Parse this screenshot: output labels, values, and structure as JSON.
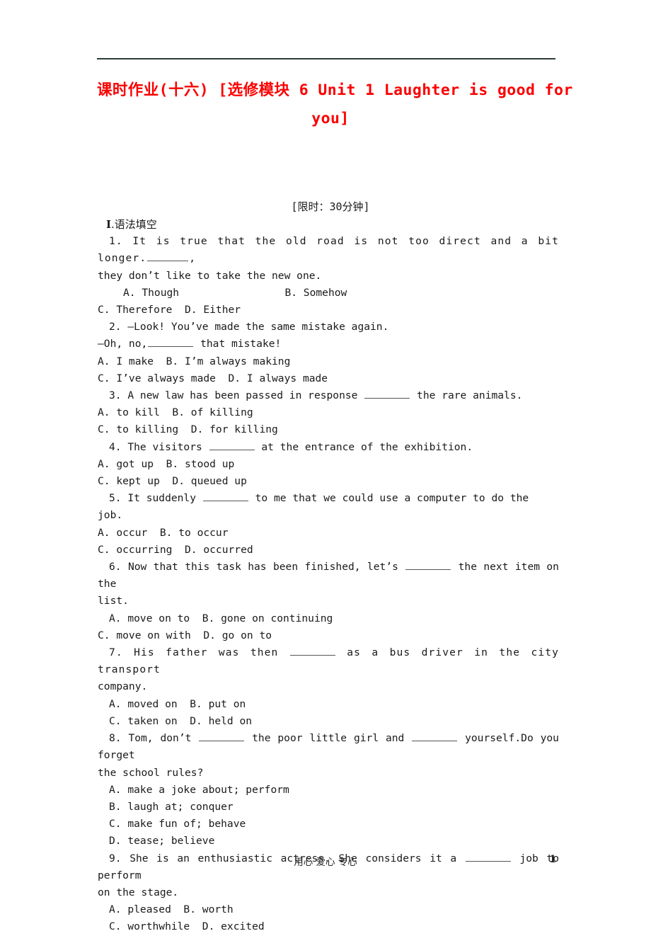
{
  "document": {
    "header_rule": true,
    "title_color": "#fb0000",
    "title_line1": "课时作业(十六)  [选修模块 6  Unit 1  Laughter is good for",
    "title_line2": "you]",
    "time_limit": "[限时：30分钟]"
  },
  "section": {
    "label_roman": "Ⅰ",
    "label_text": ".语法填空"
  },
  "questions": [
    {
      "number": "1",
      "stem_line1": "1. It is true that the old road is not too direct and a bit longer.",
      "stem_after_blank": ",",
      "stem_line2": "they don’t like to take the new one.",
      "options_lines": [
        "A. Though                 B. Somehow",
        "C. Therefore  D. Either"
      ]
    },
    {
      "number": "2",
      "stem_line1": "2. —Look! You’ve made the same mistake again.",
      "stem_line2_pre": "—Oh, no,",
      "stem_line2_post": "that mistake!",
      "options_lines": [
        "A. I make  B. I’m always making",
        "C. I’ve always made  D. I always made"
      ]
    },
    {
      "number": "3",
      "stem_pre": "3. A new law has been passed in response",
      "stem_post": "the rare animals.",
      "options_lines": [
        "A. to kill  B. of killing",
        "C. to killing  D. for killing"
      ]
    },
    {
      "number": "4",
      "stem_pre": "4. The visitors",
      "stem_post": "at the entrance of the exhibition.",
      "options_lines": [
        "A. got up  B. stood up",
        "C. kept up  D. queued up"
      ]
    },
    {
      "number": "5",
      "stem_pre": "5. It suddenly",
      "stem_post": "to me that we could use a computer to do the job.",
      "options_lines": [
        "A. occur  B. to occur",
        "C. occurring  D. occurred"
      ]
    },
    {
      "number": "6",
      "stem_pre": "6. Now that this task has been finished, let’s",
      "stem_post": "the next item on the",
      "stem_line2": "list.",
      "options_lines": [
        "A. move on to  B. gone on continuing",
        "C. move on with  D. go on to"
      ]
    },
    {
      "number": "7",
      "stem_pre": "7. His father was then",
      "stem_post": "as a bus driver in the city transport",
      "stem_line2": "company.",
      "options_lines": [
        "A. moved on  B. put on",
        "C. taken on  D. held on"
      ]
    },
    {
      "number": "8",
      "stem_pre": "8. Tom, don’t",
      "stem_mid": "the poor little girl and",
      "stem_post": "yourself.Do you forget",
      "stem_line2": "the school rules?",
      "options_lines": [
        "A. make a joke about; perform",
        "B. laugh at; conquer",
        "C. make fun of; behave",
        "D. tease; believe"
      ]
    },
    {
      "number": "9",
      "stem_pre": "9. She is an enthusiastic actress. She considers it a",
      "stem_post": "job to perform",
      "stem_line2": "on the stage.",
      "options_lines": [
        "A. pleased  B. worth",
        "C. worthwhile  D. excited"
      ]
    }
  ],
  "footer": {
    "motto": "用心 爱心 专心",
    "page_number": "1"
  }
}
